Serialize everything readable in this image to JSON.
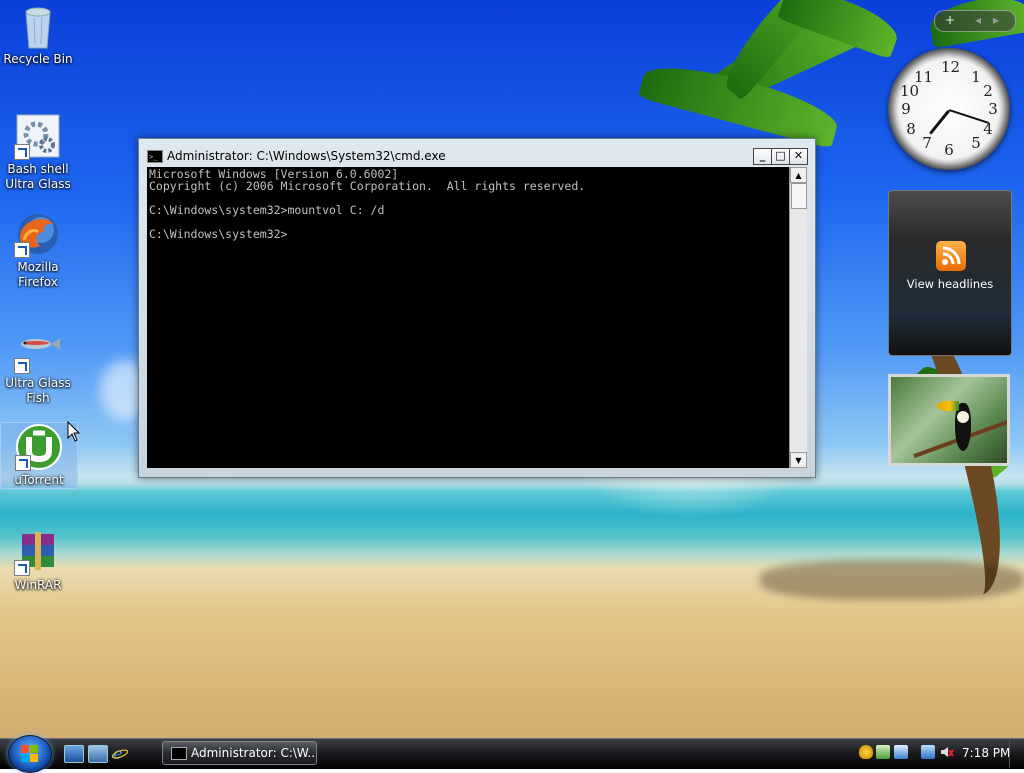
{
  "desktop": {
    "icons": [
      {
        "label": "Recycle Bin",
        "icon": "recycle-bin-icon"
      },
      {
        "label": "Bash shell Ultra Glass",
        "icon": "gears-icon"
      },
      {
        "label": "Mozilla Firefox",
        "icon": "firefox-icon"
      },
      {
        "label": "Ultra Glass Fish",
        "icon": "fish-icon"
      },
      {
        "label": "uTorrent",
        "icon": "utorrent-icon"
      },
      {
        "label": "WinRAR",
        "icon": "winrar-icon"
      }
    ]
  },
  "cmd": {
    "title": "Administrator: C:\\Windows\\System32\\cmd.exe",
    "lines": "Microsoft Windows [Version 6.0.6002]\nCopyright (c) 2006 Microsoft Corporation.  All rights reserved.\n\nC:\\Windows\\system32>mountvol C: /d\n\nC:\\Windows\\system32>",
    "buttons": {
      "minimize": "_",
      "maximize": "□",
      "close": "✕"
    }
  },
  "sidebar": {
    "add_label": "+",
    "clock": {
      "hour": 7,
      "minute": 18
    },
    "headlines_label": "View headlines"
  },
  "taskbar": {
    "task_label": "Administrator: C:\\W...",
    "time": "7:18 PM"
  },
  "colors": {
    "console_bg": "#000000",
    "console_fg": "#c0c0c0",
    "taskbar": "#1c1d20"
  }
}
